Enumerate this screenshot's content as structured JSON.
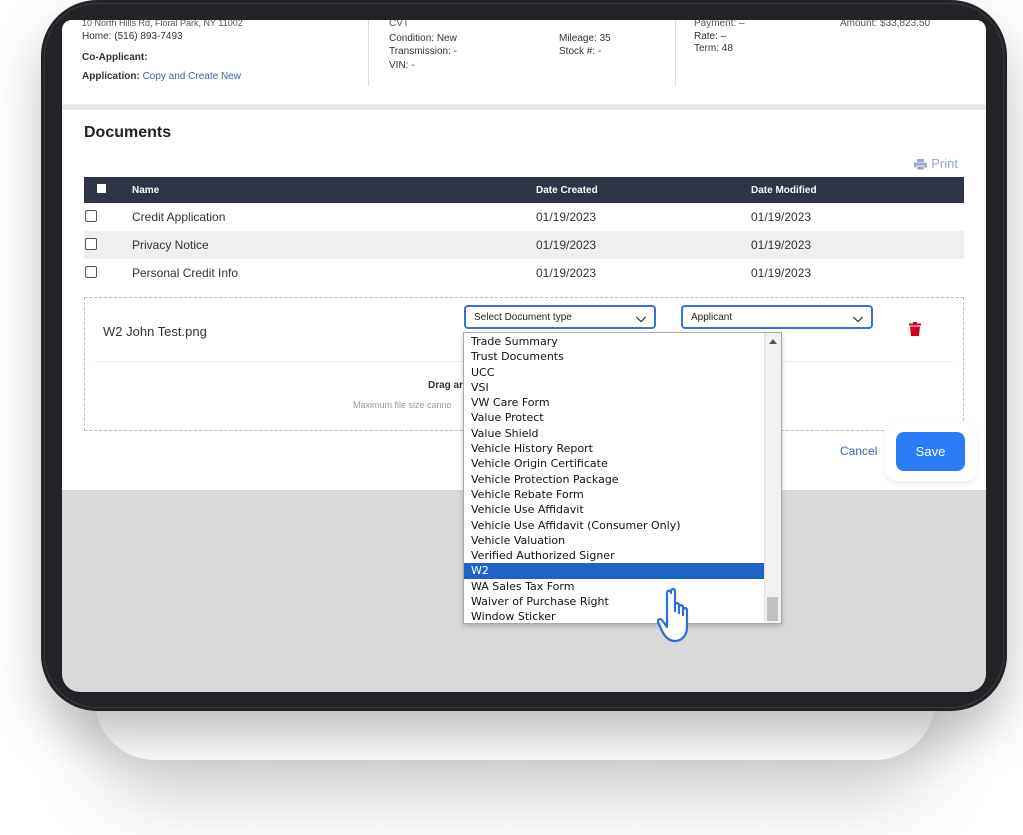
{
  "deal": {
    "address": "10 North Hills Rd, Floral Park, NY 11002",
    "home_label": "Home:",
    "home_phone": "(516) 893-7493",
    "coapplicant_label": "Co-Applicant:",
    "application_label": "Application:",
    "application_link": "Copy and Create New",
    "vehicle_top": "CVT",
    "condition_label": "Condition:",
    "condition_value": "New",
    "transmission_label": "Transmission:",
    "transmission_value": "-",
    "vin_label": "VIN:",
    "vin_value": "-",
    "mileage_label": "Mileage:",
    "mileage_value": "35",
    "stock_label": "Stock #:",
    "stock_value": "-",
    "payment_label": "Payment:",
    "payment_value": "–",
    "rate_label": "Rate:",
    "rate_value": "–",
    "term_label": "Term:",
    "term_value": "48",
    "amount_label": "Amount:",
    "amount_value": "$33,823.50"
  },
  "documents": {
    "title": "Documents",
    "print_label": "Print",
    "columns": [
      "Name",
      "Date Created",
      "Date Modified"
    ],
    "rows": [
      {
        "name": "Credit Application",
        "created": "01/19/2023",
        "modified": "01/19/2023"
      },
      {
        "name": "Privacy Notice",
        "created": "01/19/2023",
        "modified": "01/19/2023"
      },
      {
        "name": "Personal Credit Info",
        "created": "01/19/2023",
        "modified": "01/19/2023"
      }
    ]
  },
  "upload": {
    "file_name": "W2 John Test.png",
    "doc_type_placeholder": "Select Document type",
    "party_value": "Applicant",
    "drop_text": "Drag and",
    "max_text": "Maximum file size canno"
  },
  "actions": {
    "cancel": "Cancel",
    "save": "Save"
  },
  "dropdown": {
    "items": [
      "Trade Summary",
      "Trust Documents",
      "UCC",
      "VSI",
      "VW Care Form",
      "Value Protect",
      "Value Shield",
      "Vehicle History Report",
      "Vehicle Origin Certificate",
      "Vehicle Protection Package",
      "Vehicle Rebate Form",
      "Vehicle Use Affidavit",
      "Vehicle Use Affidavit (Consumer Only)",
      "Vehicle Valuation",
      "Verified Authorized Signer",
      "W2",
      "WA Sales Tax Form",
      "Waiver of Purchase Right",
      "Window Sticker"
    ],
    "selected": "W2"
  },
  "colors": {
    "accent": "#2b7df7",
    "header_dark": "#2d3546",
    "link": "#3a63b3",
    "selected": "#1f63c8",
    "delete": "#d0021b"
  }
}
